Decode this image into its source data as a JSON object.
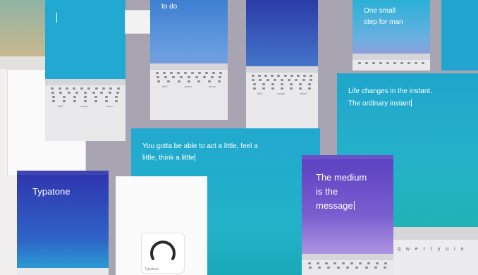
{
  "cards": {
    "top_partial": {
      "text": "to do"
    },
    "top_right": {
      "line1": "One small",
      "line2": "step for man"
    },
    "life": {
      "line1": "Life changes in the instant.",
      "line2": "The ordinary instant"
    },
    "act": {
      "line1": "You gotta be able to act a little, feel a",
      "line2": "little, think a little"
    },
    "logo": {
      "text": "Typatone"
    },
    "medium": {
      "line1": "The medium",
      "line2": "is the",
      "line3": "message"
    },
    "dial": {
      "label": "Typatone"
    }
  },
  "keyboard": {
    "left": "ABC",
    "mid": "space",
    "right": "return"
  },
  "keyboard_letters": {
    "row1": "q w e r t y u i o"
  },
  "colors": {
    "teal": "#1ea8c8",
    "purple": "#6a4fc4",
    "indigo": "#2d3bb0",
    "background": "#a9a4b1"
  }
}
